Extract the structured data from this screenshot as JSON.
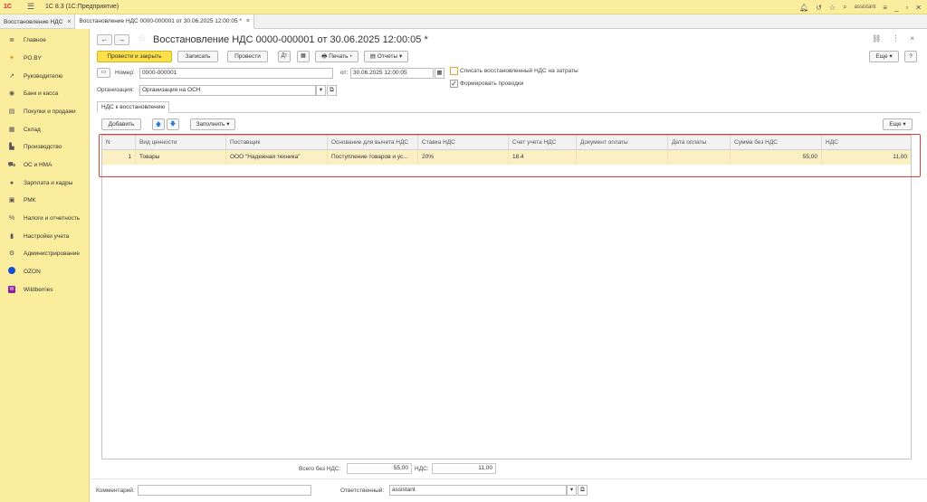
{
  "app": {
    "logo_text": "1С",
    "title": "1С 8.3  (1С:Предприятие)",
    "user": "assistant"
  },
  "tabs": [
    {
      "label": "Восстановление НДС"
    },
    {
      "label": "Восстановление НДС 0000-000001 от 30.06.2025 12:00:05 *"
    }
  ],
  "sidebar": {
    "items": [
      {
        "label": "Главное",
        "icon": "menu-icon"
      },
      {
        "label": "PO.BY",
        "icon": "sun-icon"
      },
      {
        "label": "Руководителю",
        "icon": "chart-icon"
      },
      {
        "label": "Банк и касса",
        "icon": "bank-icon"
      },
      {
        "label": "Покупки и продажи",
        "icon": "cart-icon"
      },
      {
        "label": "Склад",
        "icon": "warehouse-icon"
      },
      {
        "label": "Производство",
        "icon": "factory-icon"
      },
      {
        "label": "ОС и НМА",
        "icon": "truck-icon"
      },
      {
        "label": "Зарплата и кадры",
        "icon": "person-icon"
      },
      {
        "label": "РМК",
        "icon": "register-icon"
      },
      {
        "label": "Налоги и отчетность",
        "icon": "percent-icon"
      },
      {
        "label": "Настройки учета",
        "icon": "book-icon"
      },
      {
        "label": "Администрирование",
        "icon": "gear-icon"
      },
      {
        "label": "OZON",
        "icon": "ozon-icon"
      },
      {
        "label": "Wildberries",
        "icon": "wildberries-icon"
      }
    ]
  },
  "document": {
    "title": "Восстановление НДС 0000-000001 от 30.06.2025 12:00:05 *",
    "toolbar": {
      "post_close": "Провести и закрыть",
      "save": "Записать",
      "post": "Провести",
      "print": "Печать",
      "reports": "Отчеты",
      "more": "Еще",
      "help": "?"
    },
    "fields": {
      "number_label": "Номер:",
      "number_value": "0000-000001",
      "date_label": "от:",
      "date_value": "30.06.2025 12:00:05",
      "org_label": "Организация:",
      "org_value": "Организация на ОСН",
      "writeoff_label": "Списать восстановленный НДС на затраты",
      "writeoff_checked": false,
      "postings_label": "Формировать проводки",
      "postings_checked": true
    },
    "subtab": "НДС к восстановлению",
    "table_toolbar": {
      "add": "Добавить",
      "fill": "Заполнить",
      "more": "Еще"
    },
    "table": {
      "columns": [
        "N",
        "Вид ценности",
        "Поставщик",
        "Основание для вычета НДС",
        "Ставка НДС",
        "Счет учета НДС",
        "Документ оплаты",
        "Дата оплаты",
        "Сумма без НДС",
        "НДС"
      ],
      "rows": [
        [
          "1",
          "Товары",
          "ООО \"Надежная техника\"",
          "Поступление товаров и ус...",
          "20%",
          "18.4",
          "",
          "",
          "55,00",
          "11,00"
        ]
      ]
    },
    "totals": {
      "sum_label": "Всего без НДС:",
      "sum_value": "55,00",
      "vat_label": "НДС:",
      "vat_value": "11,00"
    },
    "footer": {
      "comment_label": "Комментарий:",
      "comment_value": "",
      "responsible_label": "Ответственный:",
      "responsible_value": "assistant"
    }
  }
}
